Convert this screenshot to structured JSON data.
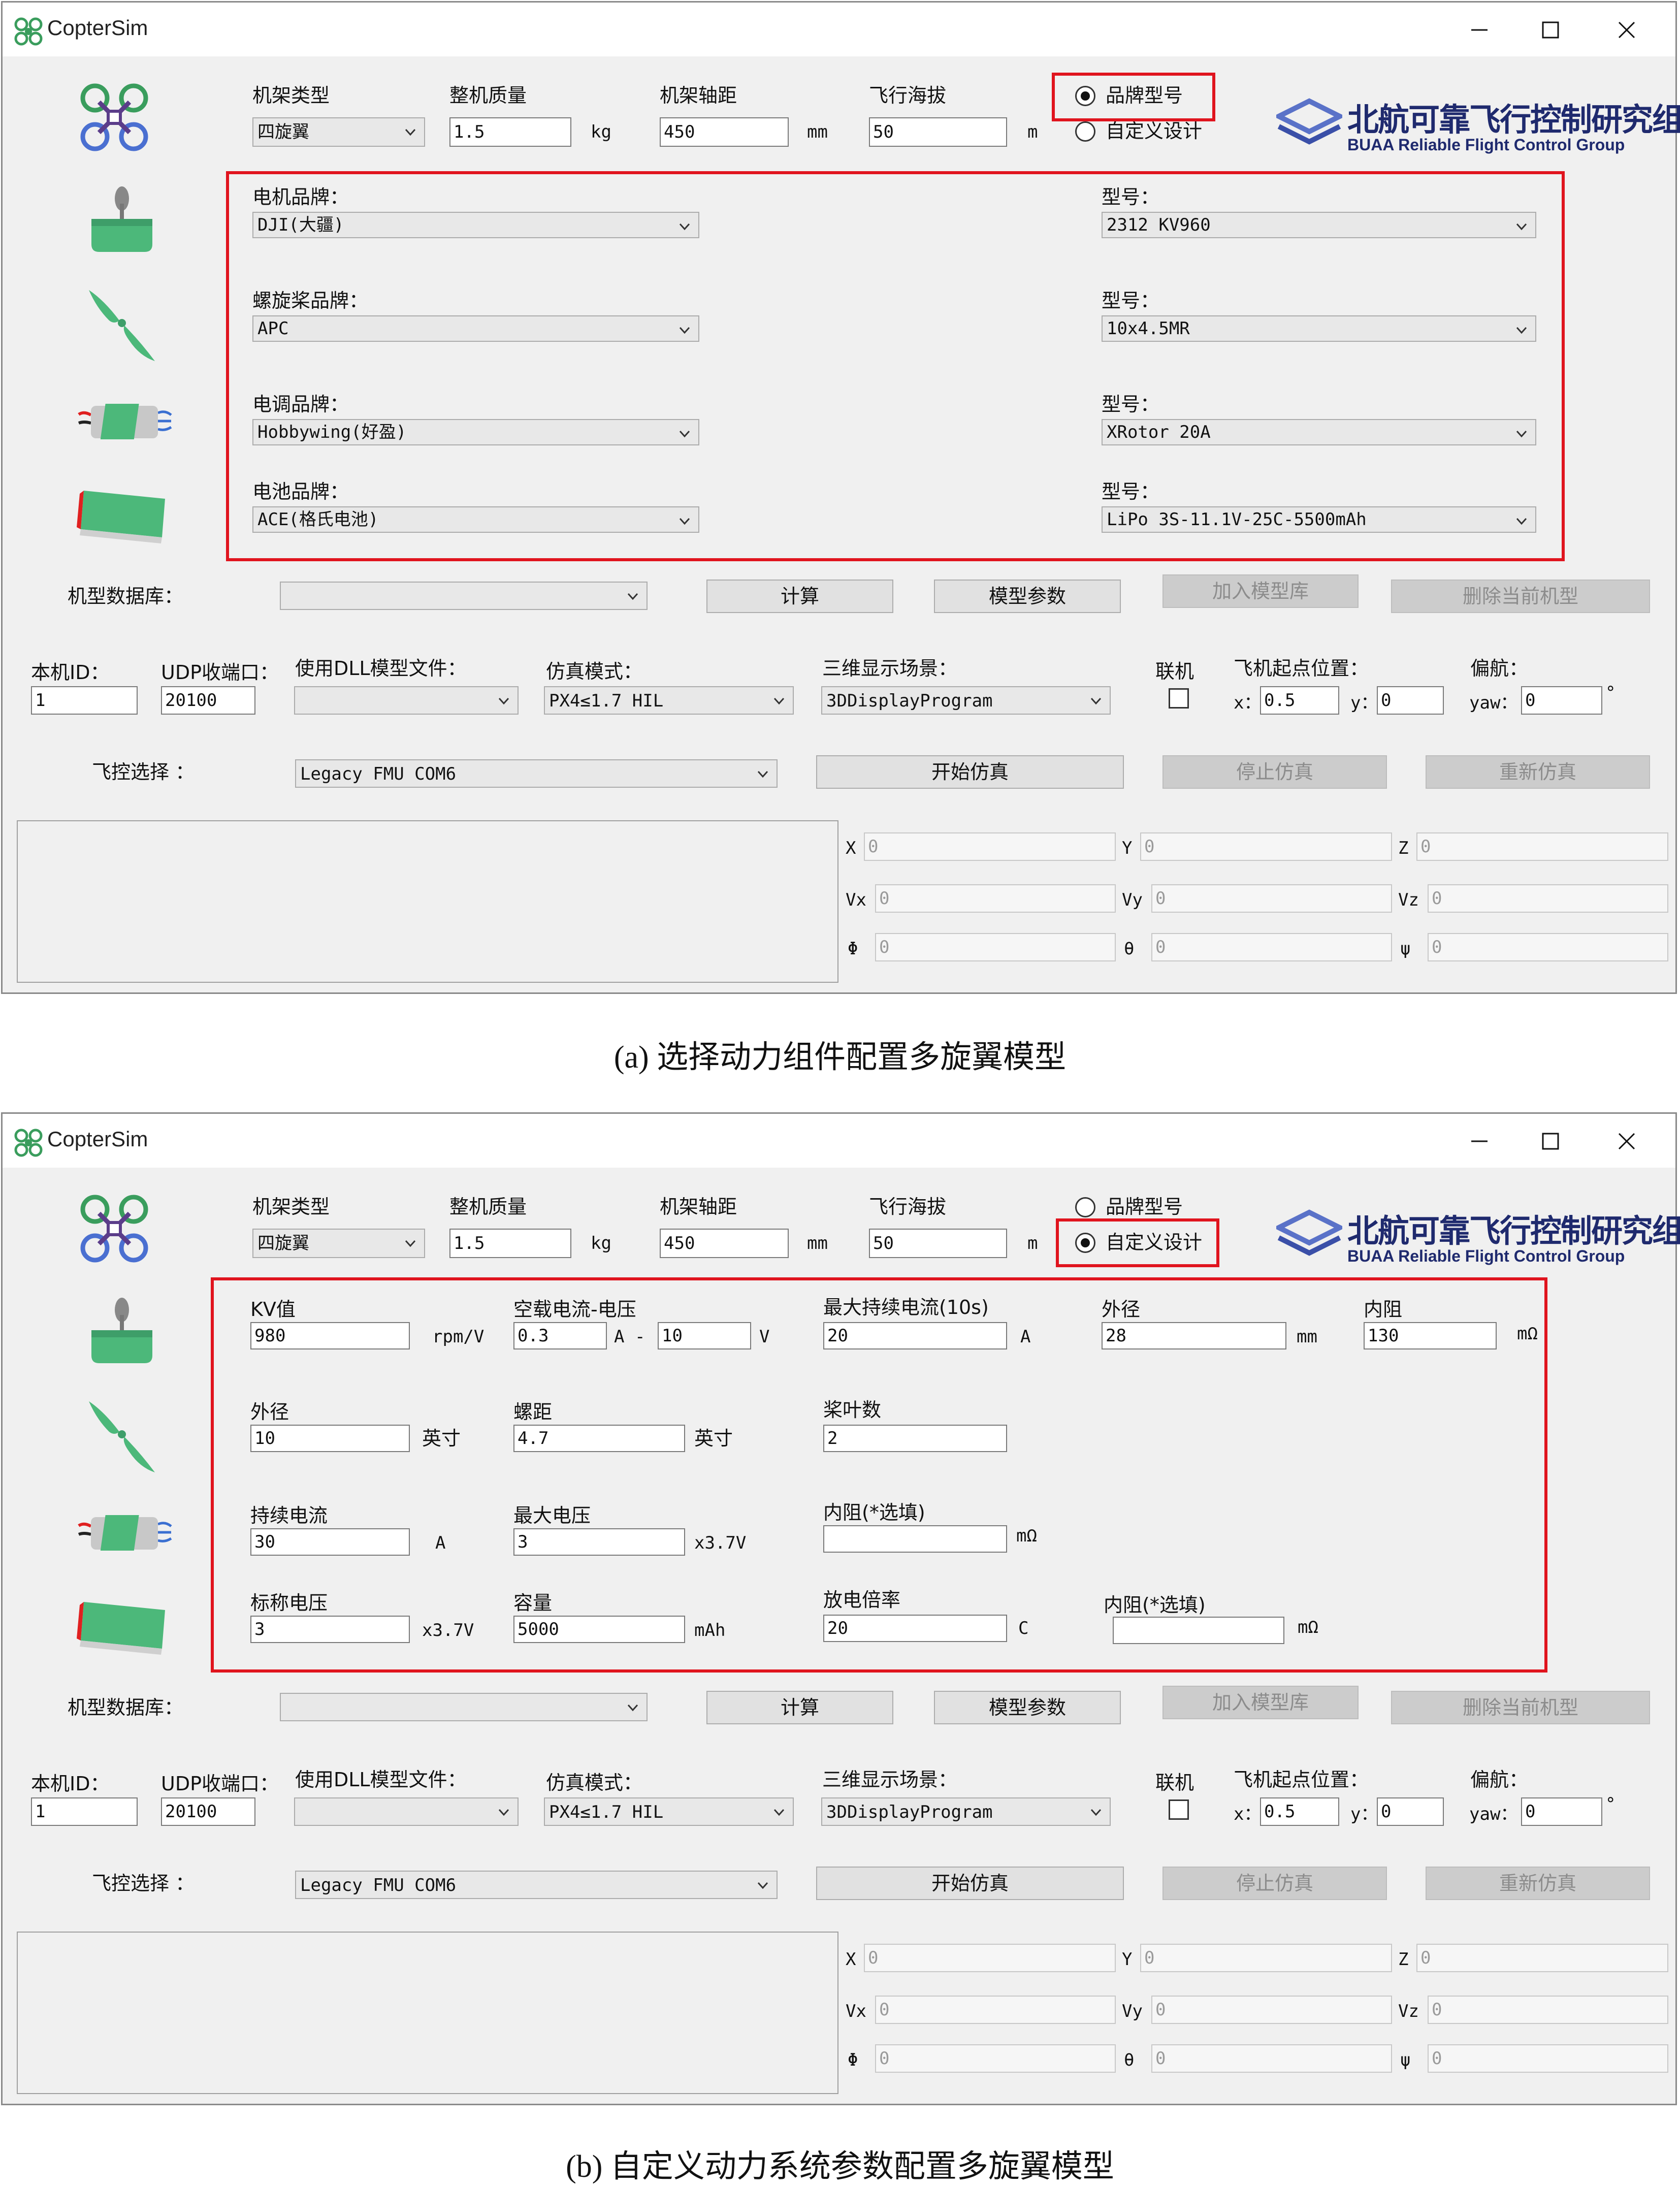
{
  "app": {
    "title": "CopterSim"
  },
  "common": {
    "frame_type_label": "机架类型",
    "frame_type_value": "四旋翼",
    "mass_label": "整机质量",
    "mass_value": "1.5",
    "mass_unit": "kg",
    "wheelbase_label": "机架轴距",
    "wheelbase_value": "450",
    "wheelbase_unit": "mm",
    "altitude_label": "飞行海拔",
    "altitude_value": "50",
    "altitude_unit": "m",
    "radio_brand_label": "品牌型号",
    "radio_custom_label": "自定义设计",
    "logo_main": "北航可靠飞行控制研究组",
    "logo_sub": "BUAA Reliable Flight Control Group",
    "db_label": "机型数据库：",
    "db_value": "",
    "calc_button": "计算",
    "model_params_button": "模型参数",
    "add_to_db_button": "加入模型库",
    "delete_model_button": "删除当前机型",
    "id_label": "本机ID：",
    "id_value": "1",
    "udp_label": "UDP收端口：",
    "udp_value": "20100",
    "dll_label": "使用DLL模型文件：",
    "dll_value": "",
    "sim_mode_label": "仿真模式：",
    "sim_mode_value": "PX4≤1.7 HIL",
    "scene_label": "三维显示场景：",
    "scene_value": "3DDisplayProgram",
    "online_label": "联机",
    "start_pos_label": "飞机起点位置：",
    "x_label": "x：",
    "x_value": "0.5",
    "y_label": "y：",
    "y_value": "0",
    "yaw_title": "偏航：",
    "yaw_label": "yaw：",
    "yaw_value": "0",
    "yaw_unit": "°",
    "fc_label": "飞控选择 ：",
    "fc_value": "Legacy FMU COM6",
    "start_sim_button": "开始仿真",
    "stop_sim_button": "停止仿真",
    "restart_sim_button": "重新仿真",
    "state": {
      "X": "X",
      "Y": "Y",
      "Z": "Z",
      "Vx": "Vx",
      "Vy": "Vy",
      "Vz": "Vz",
      "phi": "Φ",
      "theta": "θ",
      "psi": "ψ",
      "zero": "0"
    }
  },
  "panel_a": {
    "caption": "(a) 选择动力组件配置多旋翼模型",
    "radio_selected": "brand",
    "motor_brand_label": "电机品牌：",
    "motor_brand_value": "DJI(大疆)",
    "motor_model_label": "型号：",
    "motor_model_value": "2312 KV960",
    "prop_brand_label": "螺旋桨品牌：",
    "prop_brand_value": "APC",
    "prop_model_label": "型号：",
    "prop_model_value": "10x4.5MR",
    "esc_brand_label": "电调品牌：",
    "esc_brand_value": "Hobbywing(好盈)",
    "esc_model_label": "型号：",
    "esc_model_value": "XRotor 20A",
    "battery_brand_label": "电池品牌：",
    "battery_brand_value": "ACE(格氏电池)",
    "battery_model_label": "型号：",
    "battery_model_value": "LiPo 3S-11.1V-25C-5500mAh"
  },
  "panel_b": {
    "caption": "(b) 自定义动力系统参数配置多旋翼模型",
    "radio_selected": "custom",
    "kv_label": "KV值",
    "kv_value": "980",
    "kv_unit": "rpm/V",
    "noload_label": "空载电流-电压",
    "noload_current": "0.3",
    "noload_current_unit": "A -",
    "noload_voltage": "10",
    "noload_voltage_unit": "V",
    "max_cont_label": "最大持续电流(10s)",
    "max_cont_value": "20",
    "max_cont_unit": "A",
    "motor_od_label": "外径",
    "motor_od_value": "28",
    "motor_od_unit": "mm",
    "motor_r_label": "内阻",
    "motor_r_value": "130",
    "motor_r_unit": "mΩ",
    "prop_d_label": "外径",
    "prop_d_value": "10",
    "prop_d_unit": "英寸",
    "pitch_label": "螺距",
    "pitch_value": "4.7",
    "pitch_unit": "英寸",
    "blades_label": "桨叶数",
    "blades_value": "2",
    "esc_cont_label": "持续电流",
    "esc_cont_value": "30",
    "esc_cont_unit": "A",
    "esc_maxv_label": "最大电压",
    "esc_maxv_value": "3",
    "esc_maxv_unit": "x3.7V",
    "esc_r_label": "内阻(*选填)",
    "esc_r_value": "",
    "esc_r_unit": "mΩ",
    "bat_v_label": "标称电压",
    "bat_v_value": "3",
    "bat_v_unit": "x3.7V",
    "bat_cap_label": "容量",
    "bat_cap_value": "5000",
    "bat_cap_unit": "mAh",
    "bat_c_label": "放电倍率",
    "bat_c_value": "20",
    "bat_c_unit": "C",
    "bat_r_label": "内阻(*选填)",
    "bat_r_value": "",
    "bat_r_unit": "mΩ"
  },
  "colors": {
    "highlight": "#e0141e",
    "logo": "#1f2a6e",
    "icon_green": "#4cb87a",
    "quad_blue": "#4a6fd1"
  }
}
